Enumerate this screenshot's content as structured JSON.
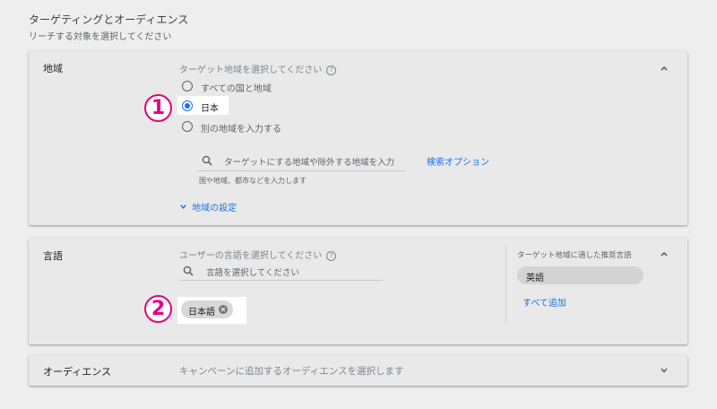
{
  "header": {
    "title": "ターゲティングとオーディエンス",
    "subtitle": "リーチする対象を選択してください"
  },
  "region": {
    "label": "地域",
    "prompt": "ターゲット地域を選択してください",
    "options": [
      {
        "label": "すべての国と地域",
        "selected": false
      },
      {
        "label": "日本",
        "selected": true
      },
      {
        "label": "別の地域を入力する",
        "selected": false
      }
    ],
    "search_placeholder": "ターゲットにする地域や除外する地域を入力",
    "search_options_link": "検索オプション",
    "search_hint": "国や地域、都市などを入力します",
    "settings_toggle": "地域の設定"
  },
  "language": {
    "label": "言語",
    "prompt": "ユーザーの言語を選択してください",
    "search_placeholder": "言語を選択してください",
    "selected_chip": "日本語",
    "recommend_title": "ターゲット地域に適した推奨言語",
    "recommended_chip": "英語",
    "add_all_link": "すべて追加"
  },
  "audience": {
    "label": "オーディエンス",
    "prompt": "キャンペーンに追加するオーディエンスを選択します"
  },
  "annotations": {
    "marker1": "1",
    "marker2": "2"
  },
  "colors": {
    "accent": "#1a73e8",
    "marker": "#e6007e",
    "card_bg": "#e9e9e9",
    "page_bg": "#eeeeee"
  }
}
